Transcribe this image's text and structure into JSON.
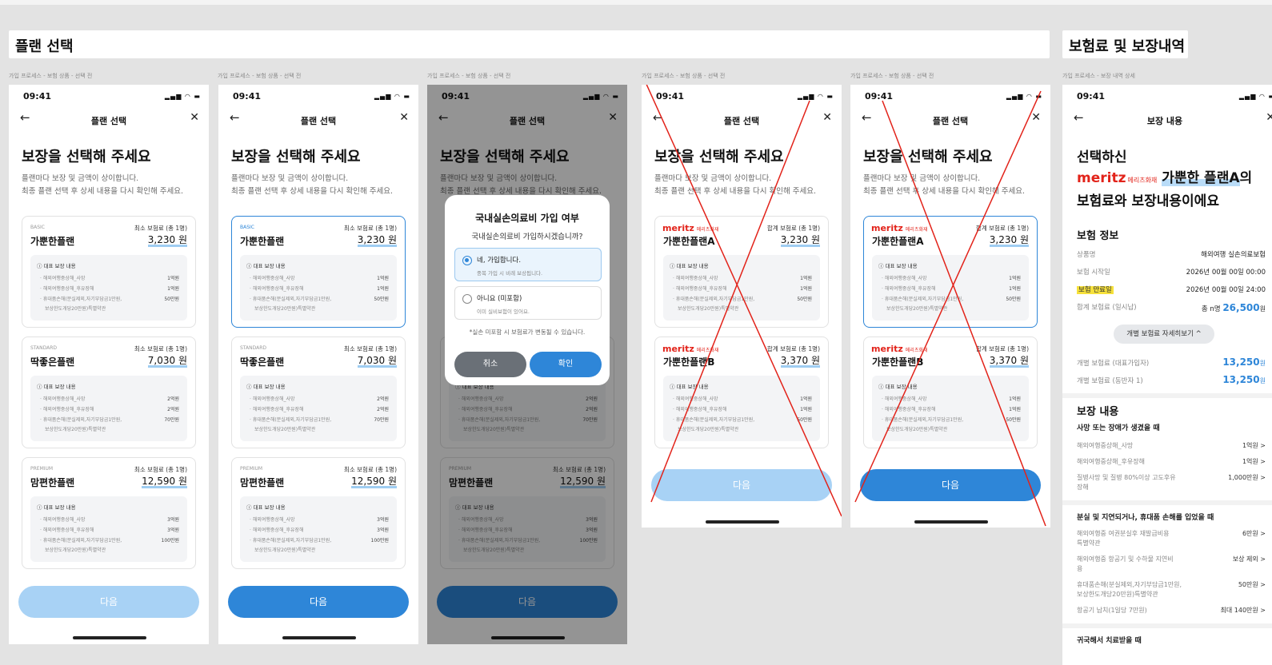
{
  "sections": {
    "plan_select": "플랜 선택",
    "premium_coverage": "보험료 및 보장내역"
  },
  "frame_labels": {
    "select": "가입 프로세스 - 보험 상품 - 선택 전",
    "detail": "가입 프로세스 - 보장 내역 상세"
  },
  "status": {
    "time": "09:41",
    "icons": "signal-icon wifi-icon battery-icon"
  },
  "select_screen": {
    "nav_title": "플랜 선택",
    "heading": "보장을 선택해 주세요",
    "sub_line1": "플랜마다 보장 및 금액이 상이합니다.",
    "sub_line2": "최종 플랜 선택 후 상세 내용을 다시 확인해 주세요.",
    "min_label": "최소 보험료 (총 1명)",
    "sum_label": "합계 보험료 (총 1명)",
    "coverage_label": "ⓘ 대표 보장 내용",
    "next_label": "다음"
  },
  "plans": [
    {
      "tier": "BASIC",
      "name": "가뿐한플랜",
      "price": "3,230 원",
      "coverage": [
        {
          "item": "해외여행중상해_사망",
          "amount": "1억원"
        },
        {
          "item": "해외여행중상해_후유장해",
          "amount": "1억원"
        },
        {
          "item": "휴대품손해(분실제외,자기부담금1만원,",
          "amount": "50만원"
        },
        {
          "item": "보상한도개당20만원)특별약관",
          "amount": ""
        }
      ]
    },
    {
      "tier": "STANDARD",
      "name": "딱좋은플랜",
      "price": "7,030 원",
      "coverage": [
        {
          "item": "해외여행중상해_사망",
          "amount": "2억원"
        },
        {
          "item": "해외여행중상해_후유장해",
          "amount": "2억원"
        },
        {
          "item": "휴대품손해(분실제외,자기부담금1만원,",
          "amount": "70만원"
        },
        {
          "item": "보상한도개당20만원)특별약관",
          "amount": ""
        }
      ]
    },
    {
      "tier": "PREMIUM",
      "name": "맘편한플랜",
      "price": "12,590 원",
      "coverage": [
        {
          "item": "해외여행중상해_사망",
          "amount": "3억원"
        },
        {
          "item": "해외여행중상해_후유장해",
          "amount": "3억원"
        },
        {
          "item": "휴대품손해(분실제외,자기부담금1만원,",
          "amount": "100만원"
        },
        {
          "item": "보상한도개당20만원)특별약관",
          "amount": ""
        }
      ]
    }
  ],
  "meritz_plans": [
    {
      "brand": "meritz",
      "brand_sub": "메리츠화재",
      "name": "가뿐한플랜A",
      "price": "3,230 원",
      "coverage": [
        {
          "item": "해외여행중상해_사망",
          "amount": "1억원"
        },
        {
          "item": "해외여행중상해_후유장해",
          "amount": "1억원"
        },
        {
          "item": "휴대품손해(분실제외,자기부담금1만원,",
          "amount": "50만원"
        },
        {
          "item": "보상한도개당20만원)특별약관",
          "amount": ""
        }
      ]
    },
    {
      "brand": "meritz",
      "brand_sub": "메리츠화재",
      "name": "가뿐한플랜B",
      "price": "3,370 원",
      "coverage": [
        {
          "item": "해외여행중상해_사망",
          "amount": "1억원"
        },
        {
          "item": "해외여행중상해_후유장해",
          "amount": "1억원"
        },
        {
          "item": "휴대품손해(분실제외,자기부담금1만원,",
          "amount": "50만원"
        },
        {
          "item": "보상한도개당20만원)특별약관",
          "amount": ""
        }
      ]
    }
  ],
  "modal": {
    "title": "국내실손의료비 가입 여부",
    "question": "국내실손의료비 가입하시겠습니까?",
    "opt_yes": "네, 가입합니다.",
    "opt_yes_sub": "중복 가입 시 비례 보상됩니다.",
    "opt_no": "아니요 (미포함)",
    "opt_no_sub": "이미 실비보험이 있어요.",
    "note": "*실손 미포함 시 보험료가 변동될 수 있습니다.",
    "cancel": "취소",
    "confirm": "확인"
  },
  "detail": {
    "nav_title": "보장 내용",
    "title_line1": "선택하신",
    "brand": "meritz",
    "brand_sub": "메리츠화재",
    "plan": "가뿐한 플랜A",
    "title_suffix": "의",
    "title_line3": "보험료와 보장내용이에요",
    "info_heading": "보험 정보",
    "info": [
      {
        "k": "상품명",
        "v": "해외여행 실손의료보험"
      },
      {
        "k": "보험 시작일",
        "v": "2026년 00월 00일 00:00"
      },
      {
        "k": "보험 만료일",
        "v": "2026년 00월 00일 24:00"
      }
    ],
    "total_label": "합계 보험료 (일시납)",
    "total_prefix": "총 n명",
    "total_value": "26,500",
    "unit": "원",
    "toggle_label": "개별 보험료 자세히보기 ^",
    "individual": [
      {
        "k": "개별 보험료 (대표가입자)",
        "v": "13,250"
      },
      {
        "k": "개별 보험료 (동반자 1)",
        "v": "13,250"
      }
    ],
    "coverage_heading": "보장 내용",
    "group1_title": "사망 또는 장애가 생겼을 때",
    "group1": [
      {
        "k": "해외여행중상해_사망",
        "v": "1억원 >"
      },
      {
        "k": "해외여행중상해_후유장해",
        "v": "1억원 >"
      },
      {
        "k": "질병사망 및 질병 80%이상 고도후유",
        "k2": "장해",
        "v": "1,000만원 >"
      }
    ],
    "group2_title": "분실 및 지연되거나, 휴대품 손해를 입었을 때",
    "group2": [
      {
        "k": "해외여행중 여권분실후 재발급비용",
        "k2": "특별약관",
        "v": "6만원 >"
      },
      {
        "k": "해외여행중 항공기 및 수하물 지연비",
        "k2": "용",
        "v": "보상 제외 >"
      },
      {
        "k": "휴대품손해(분실제외,자기부담금1만원,",
        "k2": "보상한도개당20만원)특별약관",
        "v": "50만원 >"
      },
      {
        "k": "항공기 납치(1일당 7만원)",
        "v": "최대 140만원 >"
      }
    ],
    "group3_title": "귀국해서 치료받을 때"
  }
}
